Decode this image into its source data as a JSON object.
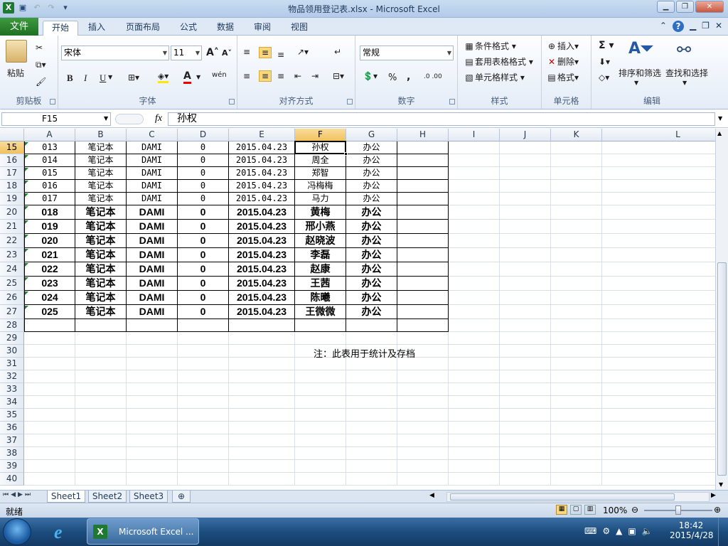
{
  "window": {
    "title": "物品领用登记表.xlsx - Microsoft Excel"
  },
  "ribbon_tabs": {
    "file": "文件",
    "home": "开始",
    "insert": "插入",
    "page_layout": "页面布局",
    "formulas": "公式",
    "data": "数据",
    "review": "审阅",
    "view": "视图"
  },
  "clipboard": {
    "paste": "粘贴",
    "label": "剪贴板"
  },
  "font": {
    "name": "宋体",
    "size": "11",
    "bold": "B",
    "italic": "I",
    "underline": "U",
    "grow": "A",
    "shrink": "A",
    "phonetic": "wén",
    "label": "字体"
  },
  "alignment": {
    "label": "对齐方式"
  },
  "number": {
    "format": "常规",
    "percent": "%",
    "comma": ",",
    "inc_dec": ".0 .00",
    "label": "数字"
  },
  "styles": {
    "conditional": "条件格式",
    "table": "套用表格格式",
    "cell_styles": "单元格样式",
    "label": "样式"
  },
  "cells": {
    "insert": "插入",
    "delete": "删除",
    "format": "格式",
    "label": "单元格"
  },
  "editing": {
    "sum": "Σ",
    "sort": "排序和筛选",
    "find": "查找和选择",
    "label": "编辑"
  },
  "formula_bar": {
    "name_box": "F15",
    "fx": "fx",
    "content": "孙权"
  },
  "columns": [
    "A",
    "B",
    "C",
    "D",
    "E",
    "F",
    "G",
    "H",
    "I",
    "J",
    "K",
    "L"
  ],
  "rows": [
    "15",
    "16",
    "17",
    "18",
    "19",
    "20",
    "21",
    "22",
    "23",
    "24",
    "25",
    "26",
    "27",
    "28",
    "29",
    "30",
    "31",
    "32",
    "33",
    "34",
    "35",
    "36",
    "37",
    "38",
    "39",
    "40"
  ],
  "data_rows": [
    [
      "013",
      "笔记本",
      "DAMI",
      "0",
      "2015.04.23",
      "孙权",
      "办公"
    ],
    [
      "014",
      "笔记本",
      "DAMI",
      "0",
      "2015.04.23",
      "周全",
      "办公"
    ],
    [
      "015",
      "笔记本",
      "DAMI",
      "0",
      "2015.04.23",
      "郑智",
      "办公"
    ],
    [
      "016",
      "笔记本",
      "DAMI",
      "0",
      "2015.04.23",
      "冯梅梅",
      "办公"
    ],
    [
      "017",
      "笔记本",
      "DAMI",
      "0",
      "2015.04.23",
      "马力",
      "办公"
    ],
    [
      "018",
      "笔记本",
      "DAMI",
      "0",
      "2015.04.23",
      "黄梅",
      "办公"
    ],
    [
      "019",
      "笔记本",
      "DAMI",
      "0",
      "2015.04.23",
      "邢小燕",
      "办公"
    ],
    [
      "020",
      "笔记本",
      "DAMI",
      "0",
      "2015.04.23",
      "赵晓波",
      "办公"
    ],
    [
      "021",
      "笔记本",
      "DAMI",
      "0",
      "2015.04.23",
      "李磊",
      "办公"
    ],
    [
      "022",
      "笔记本",
      "DAMI",
      "0",
      "2015.04.23",
      "赵康",
      "办公"
    ],
    [
      "023",
      "笔记本",
      "DAMI",
      "0",
      "2015.04.23",
      "王茜",
      "办公"
    ],
    [
      "024",
      "笔记本",
      "DAMI",
      "0",
      "2015.04.23",
      "陈曦",
      "办公"
    ],
    [
      "025",
      "笔记本",
      "DAMI",
      "0",
      "2015.04.23",
      "王微微",
      "办公"
    ]
  ],
  "note": "注：此表用于统计及存档",
  "sheets": [
    "Sheet1",
    "Sheet2",
    "Sheet3"
  ],
  "status": {
    "ready": "就绪",
    "zoom": "100%"
  },
  "taskbar": {
    "excel_button": "Microsoft Excel ...",
    "time": "18:42",
    "date": "2015/4/28"
  }
}
